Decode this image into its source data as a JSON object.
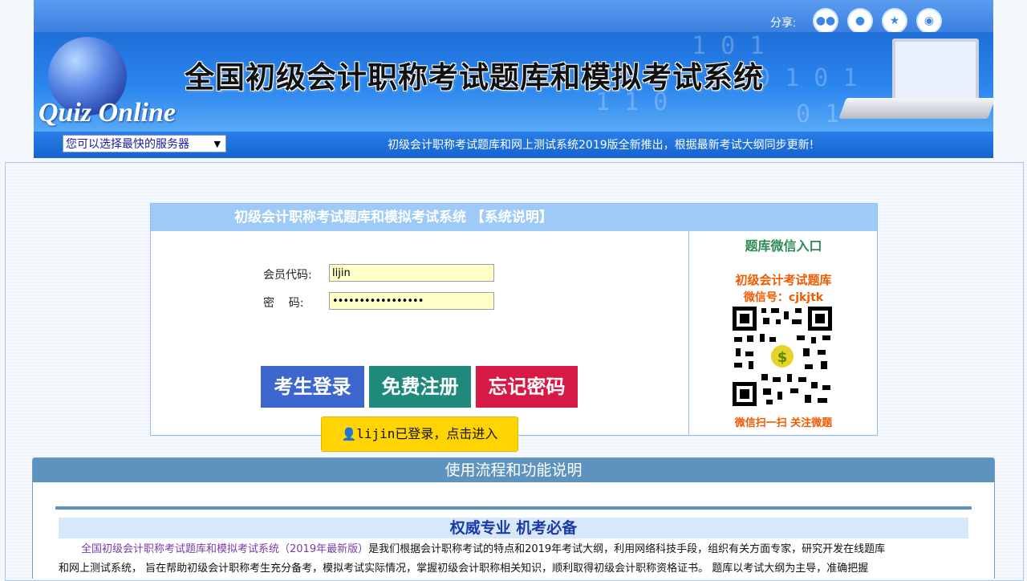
{
  "header": {
    "share_label": "分享:",
    "share_icons": [
      "wechat-icon",
      "qq-icon",
      "qzone-icon",
      "weibo-icon"
    ],
    "brand_text": "Quiz Online",
    "banner_title": "全国初级会计职称考试题库和模拟考试系统",
    "server_select": "您可以选择最快的服务器",
    "marquee": "初级会计职称考试题库和网上测试系统2019版全新推出，根据最新考试大纲同步更新!"
  },
  "login": {
    "title": "初级会计职称考试题库和模拟考试系统  【系统说明】",
    "member_label": "会员代码:",
    "member_value": "lijin",
    "password_label": "密    码:",
    "password_value": "•••••••••••••••••",
    "buttons": {
      "login": "考生登录",
      "register": "免费注册",
      "forgot": "忘记密码"
    },
    "enter_button": "lijin已登录，点击进入"
  },
  "wechat": {
    "title": "题库微信入口",
    "name": "初级会计考试题库",
    "account": "微信号：cjkjtk",
    "caption": "微信扫一扫 关注微题"
  },
  "usage": {
    "header": "使用流程和功能说明",
    "subtitle": "权威专业  机考必备",
    "line1_highlight": "全国初级会计职称考试题库和模拟考试系统（2019年最新版）",
    "line1_rest": "是我们根据会计职称考试的特点和2019年考试大纲，利用网络科技手段，组织有关方面专家，研究开发在线题库",
    "line2": "和网上测试系统，  旨在帮助初级会计职称考生充分备考，模拟考试实际情况，掌握初级会计职称相关知识，顺利取得初级会计职称资格证书。  题库以考试大纲为主导，准确把握"
  },
  "colors": {
    "header_blue": "#4f92ea",
    "login_button": "#3e66cf",
    "register_button": "#1f8a7c",
    "forgot_button": "#d71a45",
    "enter_button": "#ffd400",
    "usage_header": "#5e93be"
  }
}
